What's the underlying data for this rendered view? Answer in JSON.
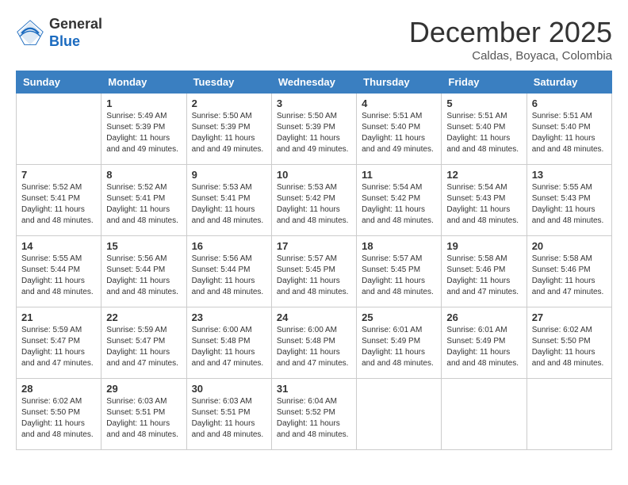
{
  "header": {
    "logo_general": "General",
    "logo_blue": "Blue",
    "month_title": "December 2025",
    "location": "Caldas, Boyaca, Colombia"
  },
  "days_of_week": [
    "Sunday",
    "Monday",
    "Tuesday",
    "Wednesday",
    "Thursday",
    "Friday",
    "Saturday"
  ],
  "weeks": [
    [
      {
        "day": "",
        "sunrise": "",
        "sunset": "",
        "daylight": ""
      },
      {
        "day": "1",
        "sunrise": "Sunrise: 5:49 AM",
        "sunset": "Sunset: 5:39 PM",
        "daylight": "Daylight: 11 hours and 49 minutes."
      },
      {
        "day": "2",
        "sunrise": "Sunrise: 5:50 AM",
        "sunset": "Sunset: 5:39 PM",
        "daylight": "Daylight: 11 hours and 49 minutes."
      },
      {
        "day": "3",
        "sunrise": "Sunrise: 5:50 AM",
        "sunset": "Sunset: 5:39 PM",
        "daylight": "Daylight: 11 hours and 49 minutes."
      },
      {
        "day": "4",
        "sunrise": "Sunrise: 5:51 AM",
        "sunset": "Sunset: 5:40 PM",
        "daylight": "Daylight: 11 hours and 49 minutes."
      },
      {
        "day": "5",
        "sunrise": "Sunrise: 5:51 AM",
        "sunset": "Sunset: 5:40 PM",
        "daylight": "Daylight: 11 hours and 48 minutes."
      },
      {
        "day": "6",
        "sunrise": "Sunrise: 5:51 AM",
        "sunset": "Sunset: 5:40 PM",
        "daylight": "Daylight: 11 hours and 48 minutes."
      }
    ],
    [
      {
        "day": "7",
        "sunrise": "Sunrise: 5:52 AM",
        "sunset": "Sunset: 5:41 PM",
        "daylight": "Daylight: 11 hours and 48 minutes."
      },
      {
        "day": "8",
        "sunrise": "Sunrise: 5:52 AM",
        "sunset": "Sunset: 5:41 PM",
        "daylight": "Daylight: 11 hours and 48 minutes."
      },
      {
        "day": "9",
        "sunrise": "Sunrise: 5:53 AM",
        "sunset": "Sunset: 5:41 PM",
        "daylight": "Daylight: 11 hours and 48 minutes."
      },
      {
        "day": "10",
        "sunrise": "Sunrise: 5:53 AM",
        "sunset": "Sunset: 5:42 PM",
        "daylight": "Daylight: 11 hours and 48 minutes."
      },
      {
        "day": "11",
        "sunrise": "Sunrise: 5:54 AM",
        "sunset": "Sunset: 5:42 PM",
        "daylight": "Daylight: 11 hours and 48 minutes."
      },
      {
        "day": "12",
        "sunrise": "Sunrise: 5:54 AM",
        "sunset": "Sunset: 5:43 PM",
        "daylight": "Daylight: 11 hours and 48 minutes."
      },
      {
        "day": "13",
        "sunrise": "Sunrise: 5:55 AM",
        "sunset": "Sunset: 5:43 PM",
        "daylight": "Daylight: 11 hours and 48 minutes."
      }
    ],
    [
      {
        "day": "14",
        "sunrise": "Sunrise: 5:55 AM",
        "sunset": "Sunset: 5:44 PM",
        "daylight": "Daylight: 11 hours and 48 minutes."
      },
      {
        "day": "15",
        "sunrise": "Sunrise: 5:56 AM",
        "sunset": "Sunset: 5:44 PM",
        "daylight": "Daylight: 11 hours and 48 minutes."
      },
      {
        "day": "16",
        "sunrise": "Sunrise: 5:56 AM",
        "sunset": "Sunset: 5:44 PM",
        "daylight": "Daylight: 11 hours and 48 minutes."
      },
      {
        "day": "17",
        "sunrise": "Sunrise: 5:57 AM",
        "sunset": "Sunset: 5:45 PM",
        "daylight": "Daylight: 11 hours and 48 minutes."
      },
      {
        "day": "18",
        "sunrise": "Sunrise: 5:57 AM",
        "sunset": "Sunset: 5:45 PM",
        "daylight": "Daylight: 11 hours and 48 minutes."
      },
      {
        "day": "19",
        "sunrise": "Sunrise: 5:58 AM",
        "sunset": "Sunset: 5:46 PM",
        "daylight": "Daylight: 11 hours and 47 minutes."
      },
      {
        "day": "20",
        "sunrise": "Sunrise: 5:58 AM",
        "sunset": "Sunset: 5:46 PM",
        "daylight": "Daylight: 11 hours and 47 minutes."
      }
    ],
    [
      {
        "day": "21",
        "sunrise": "Sunrise: 5:59 AM",
        "sunset": "Sunset: 5:47 PM",
        "daylight": "Daylight: 11 hours and 47 minutes."
      },
      {
        "day": "22",
        "sunrise": "Sunrise: 5:59 AM",
        "sunset": "Sunset: 5:47 PM",
        "daylight": "Daylight: 11 hours and 47 minutes."
      },
      {
        "day": "23",
        "sunrise": "Sunrise: 6:00 AM",
        "sunset": "Sunset: 5:48 PM",
        "daylight": "Daylight: 11 hours and 47 minutes."
      },
      {
        "day": "24",
        "sunrise": "Sunrise: 6:00 AM",
        "sunset": "Sunset: 5:48 PM",
        "daylight": "Daylight: 11 hours and 47 minutes."
      },
      {
        "day": "25",
        "sunrise": "Sunrise: 6:01 AM",
        "sunset": "Sunset: 5:49 PM",
        "daylight": "Daylight: 11 hours and 48 minutes."
      },
      {
        "day": "26",
        "sunrise": "Sunrise: 6:01 AM",
        "sunset": "Sunset: 5:49 PM",
        "daylight": "Daylight: 11 hours and 48 minutes."
      },
      {
        "day": "27",
        "sunrise": "Sunrise: 6:02 AM",
        "sunset": "Sunset: 5:50 PM",
        "daylight": "Daylight: 11 hours and 48 minutes."
      }
    ],
    [
      {
        "day": "28",
        "sunrise": "Sunrise: 6:02 AM",
        "sunset": "Sunset: 5:50 PM",
        "daylight": "Daylight: 11 hours and 48 minutes."
      },
      {
        "day": "29",
        "sunrise": "Sunrise: 6:03 AM",
        "sunset": "Sunset: 5:51 PM",
        "daylight": "Daylight: 11 hours and 48 minutes."
      },
      {
        "day": "30",
        "sunrise": "Sunrise: 6:03 AM",
        "sunset": "Sunset: 5:51 PM",
        "daylight": "Daylight: 11 hours and 48 minutes."
      },
      {
        "day": "31",
        "sunrise": "Sunrise: 6:04 AM",
        "sunset": "Sunset: 5:52 PM",
        "daylight": "Daylight: 11 hours and 48 minutes."
      },
      {
        "day": "",
        "sunrise": "",
        "sunset": "",
        "daylight": ""
      },
      {
        "day": "",
        "sunrise": "",
        "sunset": "",
        "daylight": ""
      },
      {
        "day": "",
        "sunrise": "",
        "sunset": "",
        "daylight": ""
      }
    ]
  ]
}
